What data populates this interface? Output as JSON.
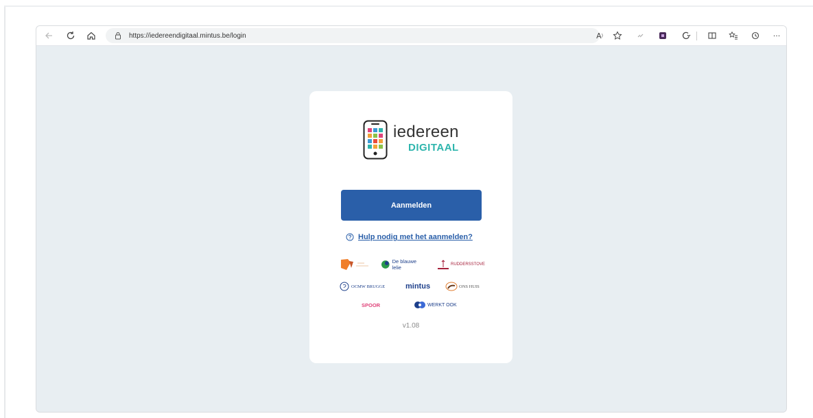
{
  "browser": {
    "url": "https://iedereendigitaal.mintus.be/login",
    "icons": [
      "back-icon",
      "refresh-icon",
      "home-icon",
      "lock-icon",
      "read-aloud-icon",
      "favorite-star-icon",
      "extension-icon",
      "app-icon",
      "copilot-icon",
      "split-screen-icon",
      "favorites-icon",
      "history-icon",
      "more-icon"
    ],
    "read_aloud_glyph": "A",
    "more_glyph": "···"
  },
  "app": {
    "logo_word1": "iedereen",
    "logo_word2": "DIGITAAL",
    "login_button": "Aanmelden",
    "help_link": "Hulp nodig met het aanmelden?",
    "partners": [
      {
        "name": "De blauwe lelie"
      },
      {
        "name": "RUDDERSSTOVE"
      },
      {
        "name": "OCMW BRUGGE"
      },
      {
        "name": "mintus"
      },
      {
        "name": "ONS HUIS"
      },
      {
        "name": "SPOOR"
      },
      {
        "name": "WERKT OOK"
      }
    ],
    "version": "v1.08"
  },
  "colors": {
    "primary": "#2a5fa9",
    "teal": "#2eb5ad",
    "background": "#e8eef2"
  }
}
